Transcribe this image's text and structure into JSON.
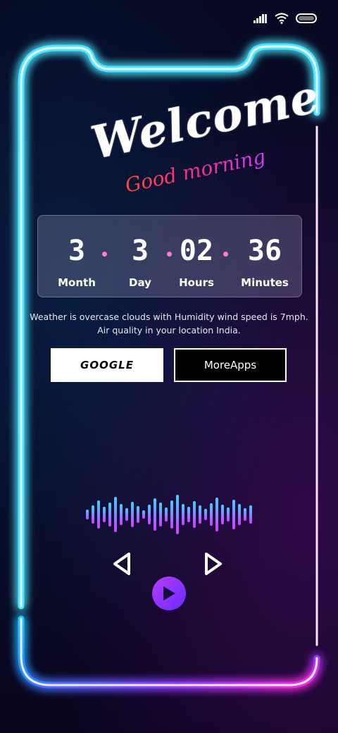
{
  "greeting": {
    "title": "Welcome",
    "subtitle": "Good morning"
  },
  "countdown": [
    {
      "value": "3",
      "label": "Month"
    },
    {
      "value": "3",
      "label": "Day"
    },
    {
      "value": "02",
      "label": "Hours"
    },
    {
      "value": "36",
      "label": "Minutes"
    }
  ],
  "weather": {
    "line1": "Weather is overcase clouds with Humidity wind speed is 7mph.",
    "line2": "Air quality in your location India."
  },
  "buttons": {
    "google": "GOOGLE",
    "more_apps": "MoreApps"
  },
  "player": {
    "prev_icon": "prev-icon",
    "next_icon": "next-icon",
    "play_icon": "play-icon"
  },
  "colors": {
    "neon_cyan": "#23c8ff",
    "neon_magenta": "#ff2bd6",
    "neon_violet": "#8b3cff",
    "accent_dot": "#ff7ad9"
  }
}
